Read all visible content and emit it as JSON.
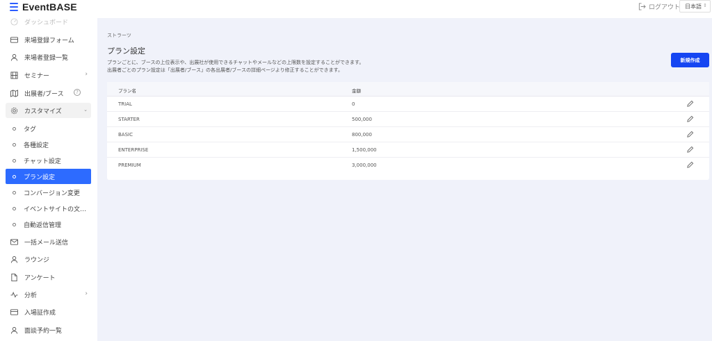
{
  "app": {
    "title": "EventBASE"
  },
  "header": {
    "logout_label": "ログアウト",
    "language": "日本語"
  },
  "sidebar": {
    "items": [
      {
        "label": "ダッシュボード",
        "icon": "dashboard-icon"
      },
      {
        "label": "来場登録フォーム",
        "icon": "form-icon"
      },
      {
        "label": "来場者登録一覧",
        "icon": "user-icon"
      },
      {
        "label": "セミナー",
        "icon": "film-icon"
      },
      {
        "label": "出展者/ブース",
        "icon": "map-icon",
        "help": "?"
      },
      {
        "label": "カスタマイズ",
        "icon": "gear-icon"
      }
    ],
    "sub_items": [
      {
        "label": "タグ"
      },
      {
        "label": "各種設定"
      },
      {
        "label": "チャット設定"
      },
      {
        "label": "プラン設定"
      },
      {
        "label": "コンバージョン変更"
      },
      {
        "label": "イベントサイトの文…"
      },
      {
        "label": "自動返信管理"
      }
    ],
    "bottom_items": [
      {
        "label": "一括メール送信",
        "icon": "mail-icon"
      },
      {
        "label": "ラウンジ",
        "icon": "user-icon"
      },
      {
        "label": "アンケート",
        "icon": "document-icon"
      },
      {
        "label": "分析",
        "icon": "activity-icon"
      },
      {
        "label": "入場証作成",
        "icon": "card-icon"
      },
      {
        "label": "面談予約一覧",
        "icon": "user-icon"
      }
    ],
    "active_item": "プラン設定"
  },
  "main": {
    "breadcrumb": "ストラーツ",
    "title": "プラン設定",
    "description": [
      "プランごとに、ブースの上位表示や、出展社が使用できるチャットやメールなどの上限数を設定することができます。",
      "出展者ごとのプラン設定は「出展者/ブース」の各出展者/ブースの詳細ページより修正することができます。"
    ],
    "new_button_label": "新規作成",
    "table": {
      "columns": [
        "プラン名",
        "金額"
      ],
      "rows": [
        {
          "name": "TRIAL",
          "price": "0"
        },
        {
          "name": "STARTER",
          "price": "500,000"
        },
        {
          "name": "BASIC",
          "price": "800,000"
        },
        {
          "name": "ENTERPRISE",
          "price": "1,500,000"
        },
        {
          "name": "PREMIUM",
          "price": "3,000,000"
        }
      ]
    }
  },
  "colors": {
    "accent": "#2d6bff",
    "button": "#1646f2",
    "main_bg": "#f0f2fa"
  }
}
